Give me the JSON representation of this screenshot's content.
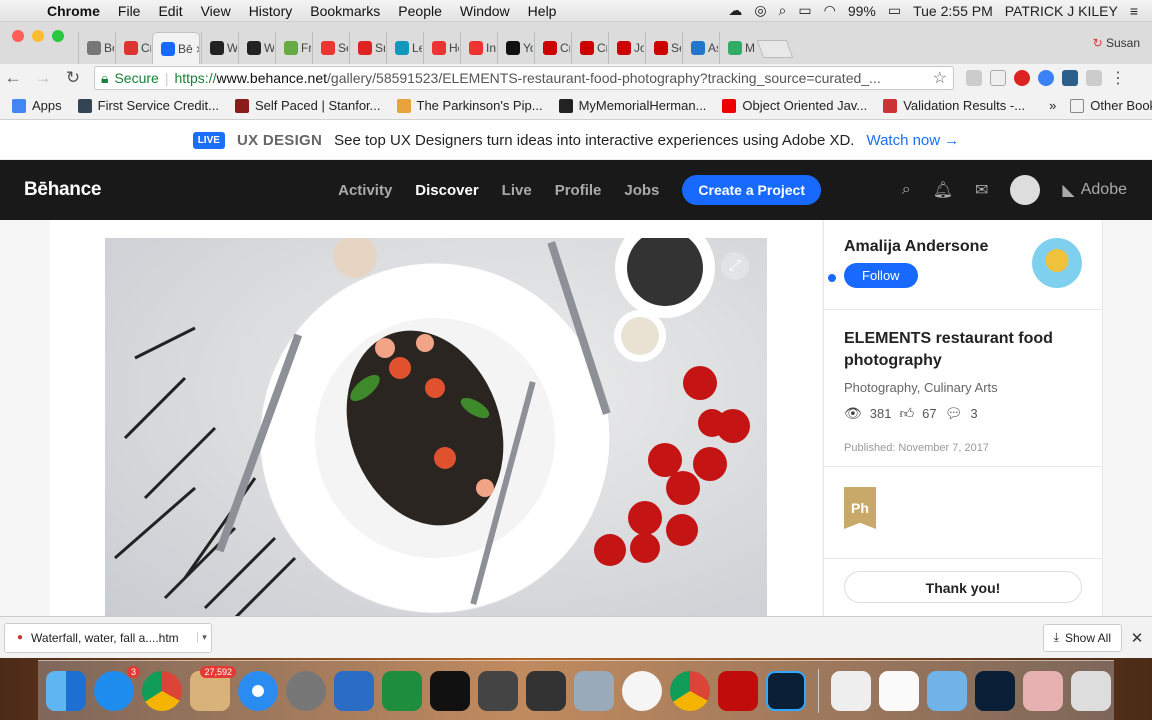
{
  "menubar": {
    "app": "Chrome",
    "items": [
      "File",
      "Edit",
      "View",
      "History",
      "Bookmarks",
      "People",
      "Window",
      "Help"
    ],
    "battery": "99%",
    "time": "Tue 2:55 PM",
    "user": "PATRICK J KILEY"
  },
  "tabs": {
    "items": [
      {
        "label": "Bo",
        "color": "#777"
      },
      {
        "label": "Cr",
        "color": "#d33"
      },
      {
        "label": "Bē",
        "color": "#1769ff",
        "active": true
      },
      {
        "label": "Wa",
        "color": "#222"
      },
      {
        "label": "Wa",
        "color": "#222"
      },
      {
        "label": "Fre",
        "color": "#6a4"
      },
      {
        "label": "Se",
        "color": "#e33"
      },
      {
        "label": "Sm",
        "color": "#d22"
      },
      {
        "label": "Le",
        "color": "#19b"
      },
      {
        "label": "Ho",
        "color": "#e33"
      },
      {
        "label": "In",
        "color": "#e33"
      },
      {
        "label": "Yo",
        "color": "#111"
      },
      {
        "label": "Cr",
        "color": "#c00"
      },
      {
        "label": "Cr",
        "color": "#c00"
      },
      {
        "label": "Jol",
        "color": "#c00"
      },
      {
        "label": "Se",
        "color": "#c00"
      },
      {
        "label": "As",
        "color": "#27c"
      },
      {
        "label": "My",
        "color": "#3a6"
      }
    ],
    "profile": "Susan"
  },
  "omnibox": {
    "secure_label": "Secure",
    "url_scheme": "https://",
    "url_host": "www.behance.net",
    "url_path": "/gallery/58591523/ELEMENTS-restaurant-food-photography?tracking_source=curated_..."
  },
  "bookmarks": {
    "items": [
      {
        "label": "Apps",
        "color": "#4285f4"
      },
      {
        "label": "First Service Credit...",
        "color": "#345"
      },
      {
        "label": "Self Paced | Stanfor...",
        "color": "#8b1a1a"
      },
      {
        "label": "The Parkinson's Pip...",
        "color": "#e8a33a"
      },
      {
        "label": "MyMemorialHerman...",
        "color": "#222"
      },
      {
        "label": "Object Oriented Jav...",
        "color": "#e00"
      },
      {
        "label": "Validation Results -...",
        "color": "#c33"
      }
    ],
    "other": "Other Bookmarks"
  },
  "banner": {
    "badge": "LIVE",
    "category": "UX DESIGN",
    "text": "See top UX Designers turn ideas into interactive experiences using Adobe XD.",
    "link": "Watch now →"
  },
  "header": {
    "logo": "Bēhance",
    "nav": [
      "Activity",
      "Discover",
      "Live",
      "Profile",
      "Jobs"
    ],
    "active_nav": "Discover",
    "cta": "Create a Project",
    "adobe": "Adobe"
  },
  "sidebar": {
    "owner_name": "Amalija Andersone",
    "follow_label": "Follow",
    "project_title": "ELEMENTS restaurant food photography",
    "fields": "Photography, Culinary Arts",
    "views": "381",
    "appreciations": "67",
    "comments": "3",
    "published": "Published: November 7, 2017",
    "tool_badge": "Ph",
    "thanks_label": "Thank you!"
  },
  "downloads": {
    "file": "Waterfall, water, fall a....htm",
    "show_all": "Show All"
  },
  "dock": {
    "badge_appstore": "3",
    "badge_mail": "27,592"
  }
}
